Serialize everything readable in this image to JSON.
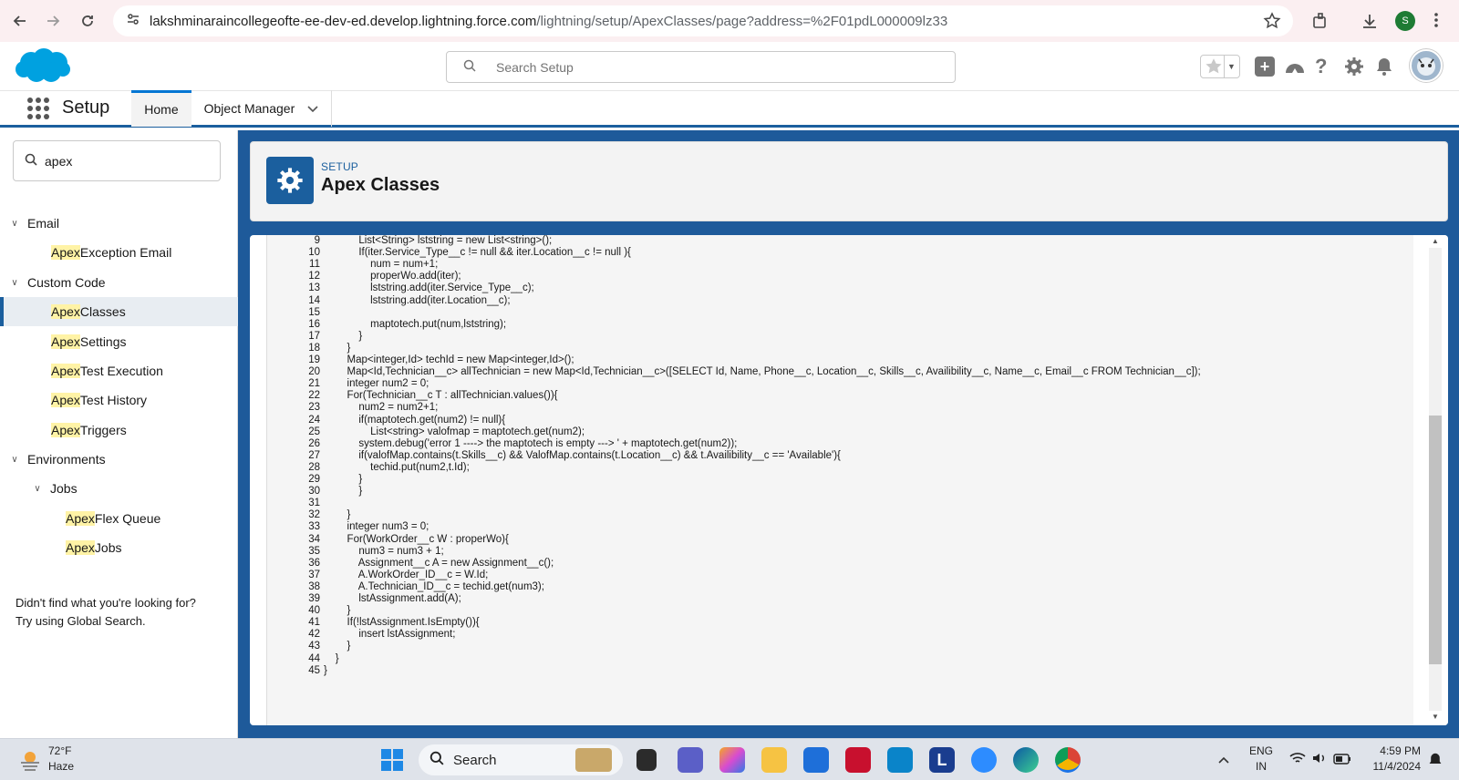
{
  "browser": {
    "url_main": "lakshminaraincollegeofte-ee-dev-ed.develop.lightning.force.com",
    "url_path": "/lightning/setup/ApexClasses/page?address=%2F01pdL000009lz33",
    "profile_initial": "S"
  },
  "header": {
    "search_placeholder": "Search Setup"
  },
  "appnav": {
    "app_name": "Setup",
    "tabs": [
      {
        "label": "Home"
      },
      {
        "label": "Object Manager"
      }
    ]
  },
  "sidebar": {
    "quickfind_value": "apex",
    "items": [
      {
        "label": "Email",
        "type": "section"
      },
      {
        "hl": "Apex",
        "rest": " Exception Email"
      },
      {
        "label": "Custom Code",
        "type": "section"
      },
      {
        "hl": "Apex",
        "rest": " Classes",
        "selected": true
      },
      {
        "hl": "Apex",
        "rest": " Settings"
      },
      {
        "hl": "Apex",
        "rest": " Test Execution"
      },
      {
        "hl": "Apex",
        "rest": " Test History"
      },
      {
        "hl": "Apex",
        "rest": " Triggers"
      },
      {
        "label": "Environments",
        "type": "section"
      },
      {
        "label": "Jobs",
        "type": "subsection"
      },
      {
        "hl": "Apex",
        "rest": " Flex Queue"
      },
      {
        "hl": "Apex",
        "rest": " Jobs"
      }
    ],
    "help_line1": "Didn't find what you're looking for?",
    "help_line2": "Try using Global Search."
  },
  "page": {
    "eyebrow": "SETUP",
    "title": "Apex Classes"
  },
  "code": {
    "lines": [
      {
        "n": "9",
        "t": "            List<String> lststring = new List<string>();"
      },
      {
        "n": "10",
        "t": "            If(iter.Service_Type__c != null && iter.Location__c != null ){"
      },
      {
        "n": "11",
        "t": "                num = num+1;"
      },
      {
        "n": "12",
        "t": "                properWo.add(iter);"
      },
      {
        "n": "13",
        "t": "                lststring.add(iter.Service_Type__c);"
      },
      {
        "n": "14",
        "t": "                lststring.add(iter.Location__c);"
      },
      {
        "n": "15",
        "t": ""
      },
      {
        "n": "16",
        "t": "                maptotech.put(num,lststring);"
      },
      {
        "n": "17",
        "t": "            }"
      },
      {
        "n": "18",
        "t": "        }"
      },
      {
        "n": "19",
        "t": "        Map<integer,Id> techId = new Map<integer,Id>();"
      },
      {
        "n": "20",
        "t": "        Map<Id,Technician__c> allTechnician = new Map<Id,Technician__c>([SELECT Id, Name, Phone__c, Location__c, Skills__c, Availibility__c, Name__c, Email__c FROM Technician__c]);"
      },
      {
        "n": "21",
        "t": "        integer num2 = 0;"
      },
      {
        "n": "22",
        "t": "        For(Technician__c T : allTechnician.values()){"
      },
      {
        "n": "23",
        "t": "            num2 = num2+1;"
      },
      {
        "n": "24",
        "t": "            if(maptotech.get(num2) != null){"
      },
      {
        "n": "25",
        "t": "                List<string> valofmap = maptotech.get(num2);"
      },
      {
        "n": "26",
        "t": "            system.debug('error 1 ----> the maptotech is empty ---> ' + maptotech.get(num2));"
      },
      {
        "n": "27",
        "t": "            if(valofMap.contains(t.Skills__c) && ValofMap.contains(t.Location__c) && t.Availibility__c == 'Available'){"
      },
      {
        "n": "28",
        "t": "                techid.put(num2,t.Id);"
      },
      {
        "n": "29",
        "t": "            }"
      },
      {
        "n": "30",
        "t": "            }"
      },
      {
        "n": "31",
        "t": ""
      },
      {
        "n": "32",
        "t": "        }"
      },
      {
        "n": "33",
        "t": "        integer num3 = 0;"
      },
      {
        "n": "34",
        "t": "        For(WorkOrder__c W : properWo){"
      },
      {
        "n": "35",
        "t": "            num3 = num3 + 1;"
      },
      {
        "n": "36",
        "t": "            Assignment__c A = new Assignment__c();"
      },
      {
        "n": "37",
        "t": "            A.WorkOrder_ID__c = W.Id;"
      },
      {
        "n": "38",
        "t": "            A.Technician_ID__c = techid.get(num3);"
      },
      {
        "n": "39",
        "t": "            lstAssignment.add(A);"
      },
      {
        "n": "40",
        "t": "        }"
      },
      {
        "n": "41",
        "t": "        If(!lstAssignment.IsEmpty()){"
      },
      {
        "n": "42",
        "t": "            insert lstAssignment;"
      },
      {
        "n": "43",
        "t": "        }"
      },
      {
        "n": "44",
        "t": "    }"
      },
      {
        "n": "45",
        "t": "}"
      }
    ]
  },
  "taskbar": {
    "temp": "72°F",
    "weather": "Haze",
    "search_label": "Search",
    "lang1": "ENG",
    "lang2": "IN",
    "time": "4:59 PM",
    "date": "11/4/2024"
  },
  "colors": {
    "brand_blue": "#1b5f9e",
    "highlight": "#fff3a6",
    "salesforce_cloud": "#00a1e0"
  },
  "icons": [
    "back-icon",
    "forward-icon",
    "reload-icon",
    "site-info-icon",
    "star-icon",
    "extensions-icon",
    "download-icon",
    "kebab-icon",
    "salesforce-logo",
    "search-icon",
    "favorites-icon",
    "add-icon",
    "trailhead-icon",
    "help-icon",
    "gear-icon",
    "bell-icon",
    "avatar",
    "app-launcher-icon",
    "chevron-down-icon",
    "windows-start-icon"
  ]
}
